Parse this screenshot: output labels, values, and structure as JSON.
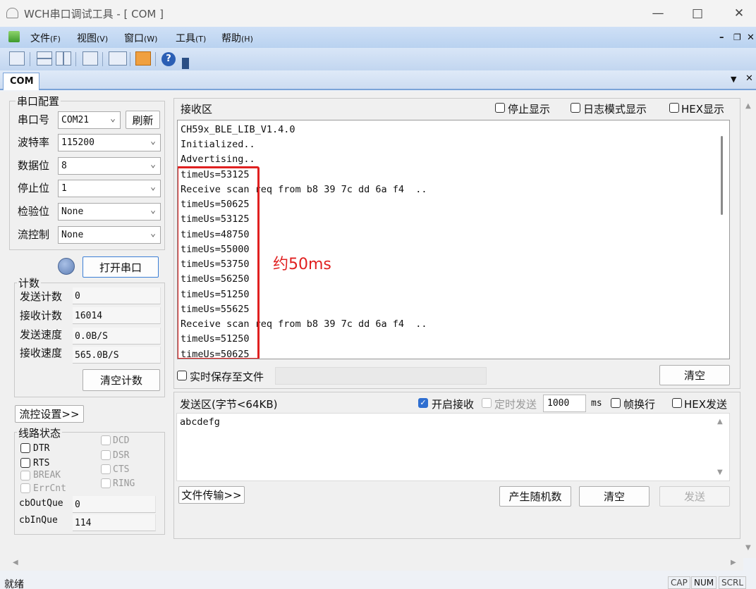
{
  "window": {
    "title": "WCH串口调试工具 - [ COM ]"
  },
  "menu": [
    {
      "label": "文件",
      "key": "(F)"
    },
    {
      "label": "视图",
      "key": "(V)"
    },
    {
      "label": "窗口",
      "key": "(W)"
    },
    {
      "label": "工具",
      "key": "(T)"
    },
    {
      "label": "帮助",
      "key": "(H)"
    }
  ],
  "tab": {
    "label": "COM"
  },
  "serial_config": {
    "legend": "串口配置",
    "port_label": "串口号",
    "port_value": "COM21",
    "refresh_label": "刷新",
    "baud_label": "波特率",
    "baud_value": "115200",
    "databits_label": "数据位",
    "databits_value": "8",
    "stopbits_label": "停止位",
    "stopbits_value": "1",
    "parity_label": "检验位",
    "parity_value": "None",
    "flow_label": "流控制",
    "flow_value": "None",
    "open_label": "打开串口"
  },
  "counts": {
    "legend": "计数",
    "sent_label": "发送计数",
    "sent_value": "0",
    "recv_label": "接收计数",
    "recv_value": "16014",
    "send_speed_label": "发送速度",
    "send_speed_value": "0.0B/S",
    "recv_speed_label": "接收速度",
    "recv_speed_value": "565.0B/S",
    "clear_label": "清空计数"
  },
  "flow_settings_label": "流控设置>>",
  "line_state": {
    "legend": "线路状态",
    "dtr": "DTR",
    "rts": "RTS",
    "break": "BREAK",
    "errcnt": "ErrCnt",
    "dcd": "DCD",
    "dsr": "DSR",
    "cts": "CTS",
    "ring": "RING",
    "outque_label": "cbOutQue",
    "outque_value": "0",
    "inque_label": "cbInQue",
    "inque_value": "114"
  },
  "receive": {
    "title": "接收区",
    "stop_display": "停止显示",
    "log_mode": "日志模式显示",
    "hex_display": "HEX显示",
    "lines": [
      "CH59x_BLE_LIB_V1.4.0",
      "Initialized..",
      "Advertising..",
      "timeUs=53125",
      "Receive scan req from b8 39 7c dd 6a f4  ..",
      "timeUs=50625",
      "timeUs=53125",
      "timeUs=48750",
      "timeUs=55000",
      "timeUs=53750",
      "timeUs=56250",
      "timeUs=51250",
      "timeUs=55625",
      "Receive scan req from b8 39 7c dd 6a f4  ..",
      "timeUs=51250",
      "timeUs=50625"
    ],
    "annotation": "约50ms",
    "save_label": "实时保存至文件",
    "clear_label": "清空"
  },
  "send": {
    "title": "发送区(字节<64KB)",
    "enable_recv": "开启接收",
    "timed_send": "定时发送",
    "interval": "1000",
    "ms": "ms",
    "frame_newline": "帧换行",
    "hex_send": "HEX发送",
    "content": "abcdefg",
    "file_transfer": "文件传输>>",
    "random": "产生随机数",
    "clear": "清空",
    "send": "发送"
  },
  "statusbar": {
    "text": "就绪",
    "cap": "CAP",
    "num": "NUM",
    "scrl": "SCRL"
  },
  "colors": {
    "annotation": "#e02020",
    "accent": "#2f6fd1"
  }
}
